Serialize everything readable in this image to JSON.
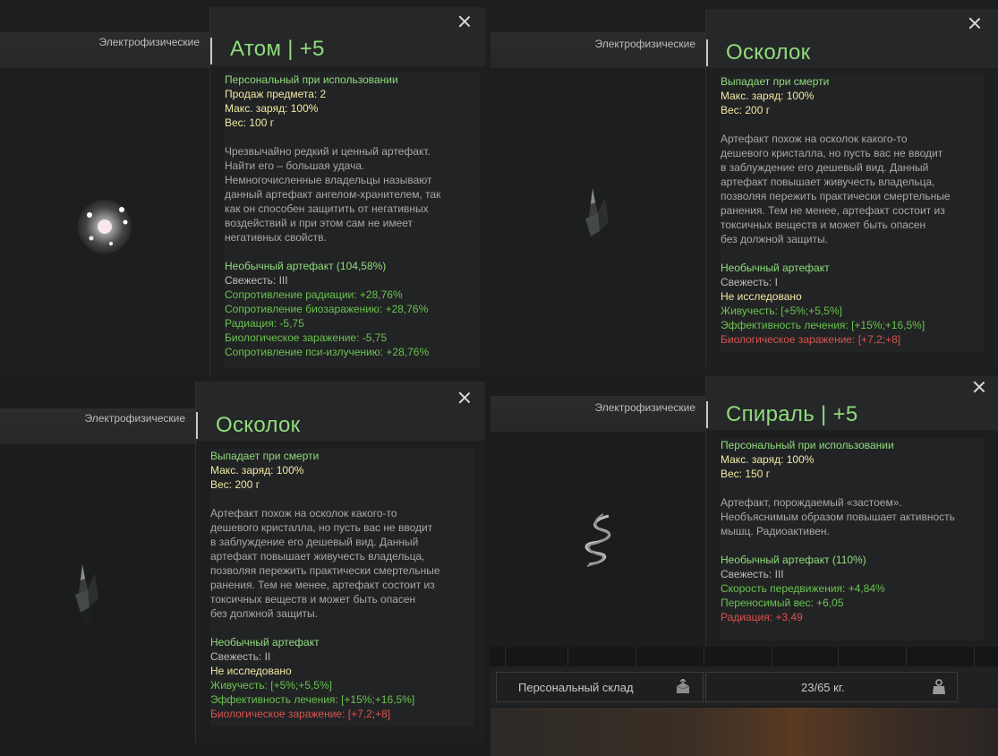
{
  "panels": [
    {
      "category": "Электрофизические",
      "title": "Атом | +5",
      "meta": [
        "Персональный при использовании",
        "Продаж предмета: 2",
        "Макс. заряд: 100%",
        "Вес: 100 г"
      ],
      "description": [
        "Чрезвычайно редкий и ценный артефакт.",
        "Найти его – большая удача.",
        "Немногочисленные владельцы называют",
        "данный артефакт ангелом-хранителем, так",
        "как он способен защитить от негативных",
        "воздействий и при этом сам не имеет",
        "негативных свойств."
      ],
      "rarity": "Необычный артефакт (104,58%)",
      "freshness": "Свежесть: III",
      "status": "",
      "stats": [
        {
          "text": "Сопротивление радиации: +28,76%",
          "color": "green"
        },
        {
          "text": "Сопротивление биозаражению: +28,76%",
          "color": "green"
        },
        {
          "text": "Радиация: -5,75",
          "color": "green"
        },
        {
          "text": "Биологическое заражение: -5,75",
          "color": "green"
        },
        {
          "text": "Сопротивление пси-излучению: +28,76%",
          "color": "green"
        }
      ]
    },
    {
      "category": "Электрофизические",
      "title": "Осколок",
      "meta": [
        "Выпадает при смерти",
        "Макс. заряд: 100%",
        "Вес: 200 г"
      ],
      "description": [
        "Артефакт похож на осколок какого-то",
        "дешевого кристалла, но пусть вас не вводит",
        "в заблуждение его дешевый вид. Данный",
        "артефакт повышает живучесть владельца,",
        "позволяя пережить практически смертельные",
        "ранения. Тем не менее, артефакт состоит из",
        "токсичных веществ и может быть опасен",
        "без должной защиты."
      ],
      "rarity": "Необычный артефакт",
      "freshness": "Свежесть: I",
      "status": "Не исследовано",
      "stats": [
        {
          "text": "Живучесть: [+5%;+5,5%]",
          "color": "green"
        },
        {
          "text": "Эффективность лечения: [+15%;+16,5%]",
          "color": "green"
        },
        {
          "text": "Биологическое заражение: [+7,2;+8]",
          "color": "red"
        }
      ]
    },
    {
      "category": "Электрофизические",
      "title": "Осколок",
      "meta": [
        "Выпадает при смерти",
        "Макс. заряд: 100%",
        "Вес: 200 г"
      ],
      "description": [
        "Артефакт похож на осколок какого-то",
        "дешевого кристалла, но пусть вас не вводит",
        "в заблуждение его дешевый вид. Данный",
        "артефакт повышает живучесть владельца,",
        "позволяя пережить практически смертельные",
        "ранения. Тем не менее, артефакт состоит из",
        "токсичных веществ и может быть опасен",
        "без должной защиты."
      ],
      "rarity": "Необычный артефакт",
      "freshness": "Свежесть: II",
      "status": "Не исследовано",
      "stats": [
        {
          "text": "Живучесть: [+5%;+5,5%]",
          "color": "green"
        },
        {
          "text": "Эффективность лечения: [+15%;+16,5%]",
          "color": "green"
        },
        {
          "text": "Биологическое заражение: [+7,2;+8]",
          "color": "red"
        }
      ]
    },
    {
      "category": "Электрофизические",
      "title": "Спираль | +5",
      "meta": [
        "Персональный при использовании",
        "Макс. заряд: 100%",
        "Вес: 150 г"
      ],
      "description": [
        "Артефакт, порождаемый «застоем».",
        "Необъяснимым образом повышает активность",
        "мышц. Радиоактивен."
      ],
      "rarity": "Необычный артефакт (110%)",
      "freshness": "Свежесть: III",
      "status": "",
      "stats": [
        {
          "text": "Скорость передвижения: +4,84%",
          "color": "green"
        },
        {
          "text": "Переносимый вес: +6,05",
          "color": "green"
        },
        {
          "text": "Радиация: +3,49",
          "color": "red"
        }
      ]
    }
  ],
  "storage": {
    "label": "Персональный склад",
    "weight": "23/65 кг."
  },
  "colors": {
    "title": "#8fdc7c",
    "meta": "#8fdc7c",
    "status": "#f1e9a3",
    "stat_green": "#69c34f",
    "stat_red": "#d9534f"
  },
  "icons": [
    "close-icon",
    "storage-box-icon",
    "weight-icon"
  ]
}
